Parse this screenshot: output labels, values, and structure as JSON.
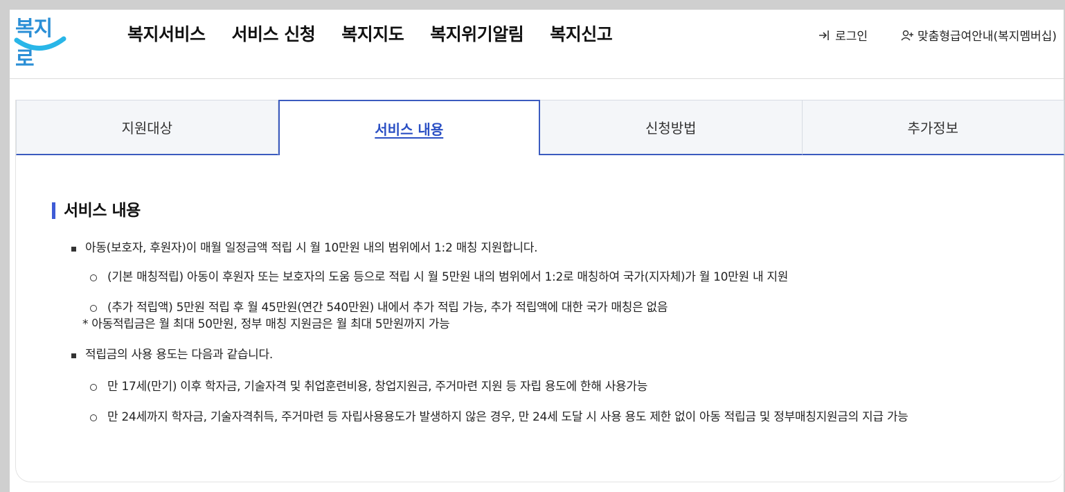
{
  "header": {
    "logo_text": "복지로",
    "nav": [
      "복지서비스",
      "서비스 신청",
      "복지지도",
      "복지위기알림",
      "복지신고"
    ],
    "login_label": "로그인",
    "member_label": "맞춤형급여안내(복지멤버십)",
    "logo_color": "#2b8fd6",
    "logo_smile_color": "#29b6e8"
  },
  "tabs": {
    "items": [
      "지원대상",
      "서비스 내용",
      "신청방법",
      "추가정보"
    ],
    "active_index": 1,
    "accent": "#3b5bbf"
  },
  "section": {
    "title": "서비스 내용",
    "bullets": [
      {
        "text": "아동(보호자, 후원자)이 매월 일정금액 적립 시 월 10만원 내의 범위에서 1:2 매칭 지원합니다.",
        "subs": [
          "(기본 매칭적립) 아동이 후원자 또는 보호자의 도움 등으로 적립 시 월 5만원 내의 범위에서 1:2로 매칭하여 국가(지자체)가 월 10만원 내 지원",
          "(추가 적립액) 5만원 적립 후 월 45만원(연간 540만원) 내에서 추가 적립 가능, 추가 적립액에 대한 국가 매칭은 없음"
        ],
        "note": "* 아동적립금은 월 최대 50만원, 정부 매칭 지원금은 월 최대 5만원까지 가능"
      },
      {
        "text": "적립금의 사용 용도는 다음과 같습니다.",
        "subs": [
          "만 17세(만기) 이후 학자금, 기술자격 및 취업훈련비용, 창업지원금, 주거마련 지원 등 자립 용도에 한해 사용가능",
          "만 24세까지 학자금, 기술자격취득, 주거마련 등 자립사용용도가 발생하지 않은 경우, 만 24세 도달 시 사용 용도 제한 없이 아동 적립금 및 정부매칭지원금의 지급 가능"
        ]
      }
    ]
  }
}
